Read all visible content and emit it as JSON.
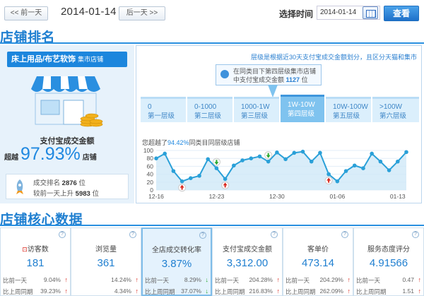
{
  "topbar": {
    "prev_day_label": "<< 前一天",
    "current_date": "2014-01-14",
    "next_day_label": "后一天 >>",
    "select_time_label": "选择时间",
    "date_input_value": "2014-01-14",
    "search_button_label": "查看"
  },
  "rank_section": {
    "title": "店铺排名",
    "shop_category": "床上用品/布艺软饰",
    "shop_type": "集市店铺",
    "pay_label": "支付宝成交金额",
    "exceed_prefix": "超越",
    "exceed_percent": "97.93%",
    "exceed_suffix": "店铺",
    "rank_label": "成交排名",
    "rank_value": "2876",
    "rank_unit": "位",
    "change_label": "较前一天上升",
    "change_value": "5983",
    "change_unit": "位",
    "tier_note": "层级是根据近30天支付宝成交金额划分，且区分天猫和集市",
    "tip_line1": "在同类目下第四层级集市店铺",
    "tip_line2_prefix": "中支付宝成交金额",
    "tip_line2_value": "1127",
    "tip_line2_suffix": "位",
    "tiers": [
      {
        "range": "0",
        "name": "第一层级"
      },
      {
        "range": "0-1000",
        "name": "第二层级"
      },
      {
        "range": "1000-1W",
        "name": "第三层级"
      },
      {
        "range": "1W-10W",
        "name": "第四层级"
      },
      {
        "range": "10W-100W",
        "name": "第五层级"
      },
      {
        "range": ">100W",
        "name": "第六层级"
      }
    ],
    "chart_note_prefix": "您超越了",
    "chart_note_value": "94.42%",
    "chart_note_suffix": "同类目同层级店铺"
  },
  "chart_data": {
    "type": "line",
    "x": [
      "12-16",
      "12-17",
      "12-18",
      "12-19",
      "12-20",
      "12-21",
      "12-22",
      "12-23",
      "12-24",
      "12-25",
      "12-26",
      "12-27",
      "12-28",
      "12-29",
      "12-30",
      "12-31",
      "01-01",
      "01-02",
      "01-03",
      "01-04",
      "01-05",
      "01-06",
      "01-07",
      "01-08",
      "01-09",
      "01-10",
      "01-11",
      "01-12",
      "01-13",
      "01-14"
    ],
    "x_tick_labels": [
      "12-16",
      "12-23",
      "12-30",
      "01-06",
      "01-13"
    ],
    "y_ticks": [
      0,
      20,
      40,
      60,
      80,
      100
    ],
    "ylim": [
      0,
      100
    ],
    "values": [
      80,
      92,
      48,
      22,
      30,
      36,
      78,
      55,
      28,
      62,
      75,
      80,
      85,
      72,
      95,
      78,
      94,
      97,
      72,
      94,
      40,
      22,
      48,
      62,
      55,
      92,
      72,
      50,
      72,
      96
    ],
    "series_color": "#2aa0d8",
    "area_color": "#cfe9f8",
    "markers_up_index": [
      3,
      8,
      20
    ],
    "markers_down_index": [
      7,
      13
    ],
    "grid": true
  },
  "core_section": {
    "title": "店铺核心数据",
    "cards": [
      {
        "title": "访客数",
        "value": "181",
        "row1_label": "比前一天",
        "row1_value": "9.04%",
        "row1_dir": "up",
        "row2_label": "比上周同期",
        "row2_value": "39.23%",
        "row2_dir": "up"
      },
      {
        "title": "浏览量",
        "value": "361",
        "row1_label": "",
        "row1_value": "14.24%",
        "row1_dir": "up",
        "row2_label": "",
        "row2_value": "4.34%",
        "row2_dir": "up"
      },
      {
        "title": "全店成交转化率",
        "value": "3.87%",
        "row1_label": "比前一天",
        "row1_value": "8.29%",
        "row1_dir": "down",
        "row2_label": "比上周同期",
        "row2_value": "37.07%",
        "row2_dir": "down"
      },
      {
        "title": "支付宝成交金额",
        "value": "3,312.00",
        "row1_label": "比前一天",
        "row1_value": "204.28%",
        "row1_dir": "up",
        "row2_label": "比上周同期",
        "row2_value": "216.83%",
        "row2_dir": "up"
      },
      {
        "title": "客单价",
        "value": "473.14",
        "row1_label": "比前一天",
        "row1_value": "204.29%",
        "row1_dir": "up",
        "row2_label": "比上周同期",
        "row2_value": "262.09%",
        "row2_dir": "up"
      },
      {
        "title": "服务态度评分",
        "value": "4.91566",
        "row1_label": "比前一天",
        "row1_value": "0.47",
        "row1_dir": "up",
        "row2_label": "比上周同期",
        "row2_value": "1.51",
        "row2_dir": "up"
      }
    ]
  }
}
